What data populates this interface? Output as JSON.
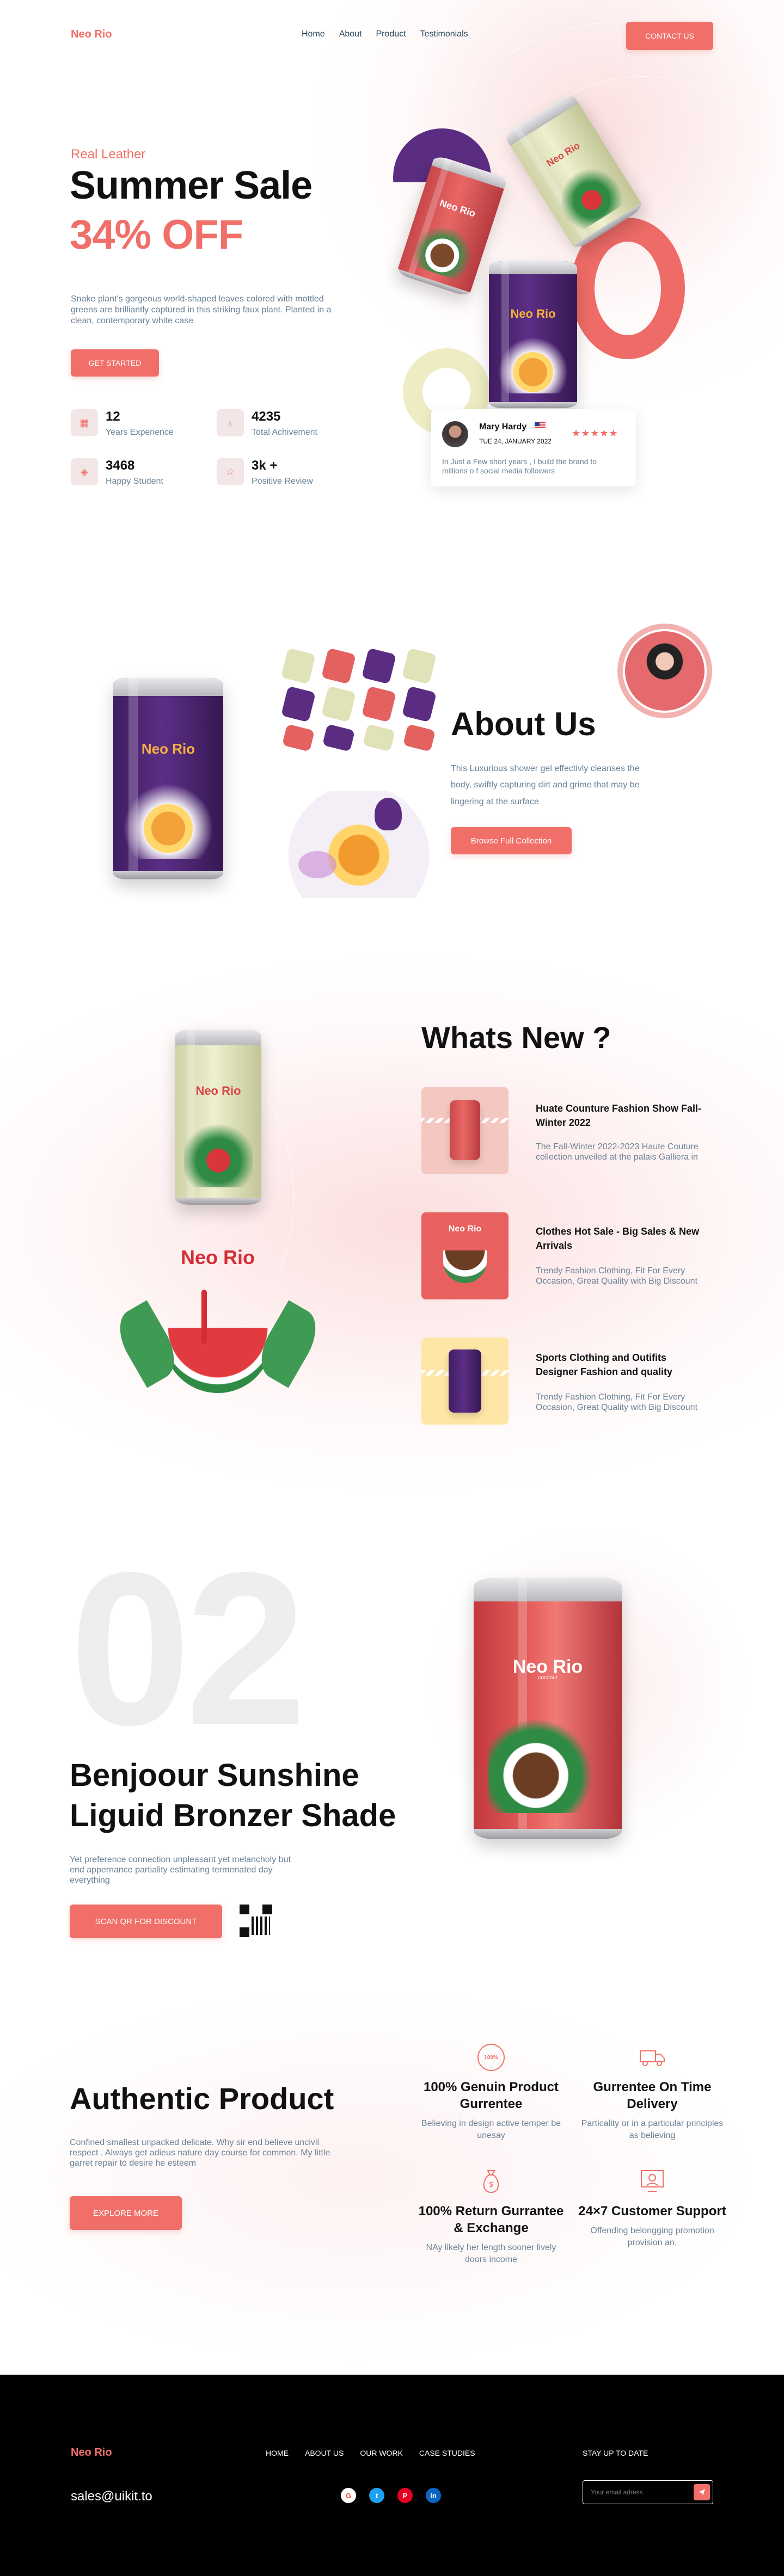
{
  "nav": {
    "logo": "Neo Rio",
    "links": [
      "Home",
      "About",
      "Product",
      "Testimonials"
    ],
    "cta": "CONTACT US"
  },
  "hero": {
    "eyebrow": "Real Leather",
    "title": "Summer Sale",
    "discount": "34% OFF",
    "description": "Snake plant's gorgeous world-shaped leaves colored with mottled greens are brilliantly captured in this striking faux plant. Planted in a clean, contemporary white case",
    "button": "GET STARTED",
    "stats": [
      {
        "num": "12",
        "label": "Years Experience",
        "icon": "calendar-icon"
      },
      {
        "num": "4235",
        "label": "Total Achivement",
        "icon": "award-icon"
      },
      {
        "num": "3468",
        "label": "Happy Student",
        "icon": "layers-icon"
      },
      {
        "num": "3k +",
        "label": "Positive Review",
        "icon": "star-icon"
      }
    ],
    "review": {
      "name": "Mary Hardy",
      "date": "TUE 24, JANUARY 2022",
      "stars": 5,
      "text": "In Just a Few short years , I build the brand to millions o f social media followers"
    }
  },
  "about": {
    "title": "About Us",
    "description": "This Luxurious shower gel effectivly cleanses the body, swiftly capturing dirt and grime that may be lingering at the surface",
    "button": "Browse Full Collection"
  },
  "whats_new": {
    "title": "Whats New ?",
    "items": [
      {
        "title": "Huate Counture Fashion Show Fall-Winter 2022",
        "desc": "The Fall-Winter 2022-2023 Haute Couture collection unveiled at the palais Galliera in"
      },
      {
        "title": "Clothes Hot Sale - Big Sales & New Arrivals",
        "desc": "Trendy Fashion Clothing, Fit For Every Occasion, Great Quality with Big Discount"
      },
      {
        "title": "Sports Clothing and Outifits Designer Fashion and quality",
        "desc": "Trendy Fashion Clothing, Fit For Every Occasion, Great Quality with Big Discount"
      }
    ]
  },
  "product": {
    "number": "02",
    "title_line1": "Benjoour Sunshine",
    "title_line2": "Liguid Bronzer Shade",
    "description": "Yet preference connection unpleasant yet melancholy but end appernance partiality estimating termenated day everything",
    "button": "SCAN QR FOR DISCOUNT"
  },
  "authentic": {
    "title": "Authentic Product",
    "description": "Confined smallest unpacked delicate. Why sir end believe uncivil respect . Always get adieus nature day course for common. My little garret repair to desire he esteem",
    "button": "EXPLORE MORE",
    "features": [
      {
        "title": "100% Genuin Product Gurrentee",
        "desc": "Believing in design active temper be unesay",
        "icon": "badge-icon"
      },
      {
        "title": "Gurrentee On Time Delivery",
        "desc": "Particality or in a particular principles as believing",
        "icon": "truck-icon"
      },
      {
        "title": "100% Return Gurrantee & Exchange",
        "desc": "NAy likely her length sooner lively doors income",
        "icon": "money-bag-icon"
      },
      {
        "title": "24×7 Customer Support",
        "desc": "Offending belongging promotion provision an.",
        "icon": "support-icon"
      }
    ]
  },
  "can_labels": {
    "brand": "Neo Rio",
    "sub": "coconut"
  },
  "footer": {
    "logo": "Neo Rio",
    "email": "sales@uikit.to",
    "links": [
      "HOME",
      "ABOUT US",
      "OUR WORK",
      "CASE STUDIES"
    ],
    "newsletter_title": "STAY UP TO DATE",
    "email_placeholder": "Your email adress"
  },
  "colors": {
    "accent": "#f07069",
    "purple": "#5b2d82",
    "cream": "#e8e9c6",
    "red_can": "#e75d5b",
    "footer_bg": "#000000"
  }
}
